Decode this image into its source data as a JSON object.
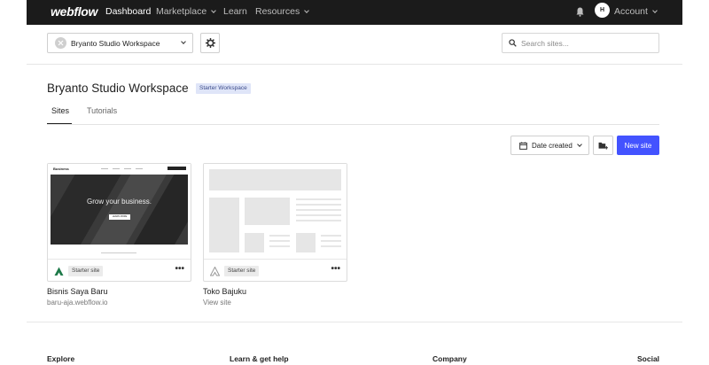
{
  "nav": {
    "logo": "webflow",
    "items": [
      {
        "label": "Dashboard"
      },
      {
        "label": "Marketplace"
      },
      {
        "label": "Learn"
      },
      {
        "label": "Resources"
      }
    ],
    "avatar_initial": "H",
    "account_label": "Account"
  },
  "workspace": {
    "selector_label": "Bryanto Studio Workspace",
    "title": "Bryanto Studio Workspace",
    "badge": "Starter Workspace"
  },
  "search": {
    "placeholder": "Search sites..."
  },
  "tabs": [
    {
      "label": "Sites",
      "active": true
    },
    {
      "label": "Tutorials",
      "active": false
    }
  ],
  "toolbar": {
    "sort_label": "Date created",
    "new_site_label": "New site"
  },
  "sites": [
    {
      "name": "Bisnis Saya Baru",
      "url": "baru-aja.webflow.io",
      "tag": "Starter site",
      "preview": {
        "brand": "Business",
        "headline": "Grow your business.",
        "cta": "LEARN MORE"
      }
    },
    {
      "name": "Toko Bajuku",
      "url": "View site",
      "tag": "Starter site"
    }
  ],
  "footer": {
    "columns": [
      "Explore",
      "Learn & get help",
      "Company",
      "Social"
    ]
  },
  "colors": {
    "nav_bg": "#1b1b1b",
    "accent": "#4353ff",
    "badge_bg": "#dfe5f8"
  }
}
